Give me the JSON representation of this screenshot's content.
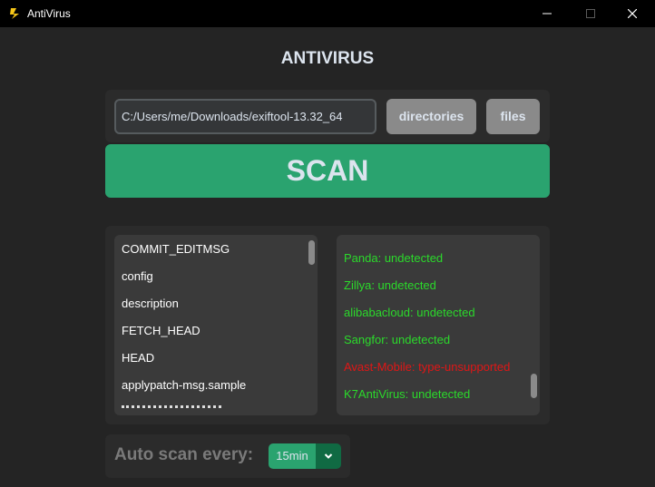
{
  "window": {
    "title": "AntiVirus"
  },
  "header": {
    "title": "ANTIVIRUS"
  },
  "path_input": {
    "value": "C:/Users/me/Downloads/exiftool-13.32_64"
  },
  "buttons": {
    "directories": "directories",
    "files": "files",
    "scan": "SCAN"
  },
  "files_list": [
    "COMMIT_EDITMSG",
    "config",
    "description",
    "FETCH_HEAD",
    "HEAD",
    "applypatch-msg.sample"
  ],
  "results": [
    {
      "text": "Panda: undetected",
      "status": "undetected"
    },
    {
      "text": "Zillya: undetected",
      "status": "undetected"
    },
    {
      "text": "alibabacloud: undetected",
      "status": "undetected"
    },
    {
      "text": "Sangfor: undetected",
      "status": "undetected"
    },
    {
      "text": "Avast-Mobile: type-unsupported",
      "status": "type-unsupported"
    },
    {
      "text": "K7AntiVirus: undetected",
      "status": "undetected"
    }
  ],
  "auto_scan": {
    "label": "Auto scan every:",
    "value": "15min"
  },
  "colors": {
    "accent": "#2aa36f",
    "accent_dark": "#106a43",
    "undetected": "#2bd92b",
    "unsupported": "#e01616",
    "button_gray": "#8a8a8a"
  },
  "icons": [
    "app-logo-icon",
    "minimize-icon",
    "maximize-icon",
    "close-icon",
    "chevron-down-icon"
  ]
}
